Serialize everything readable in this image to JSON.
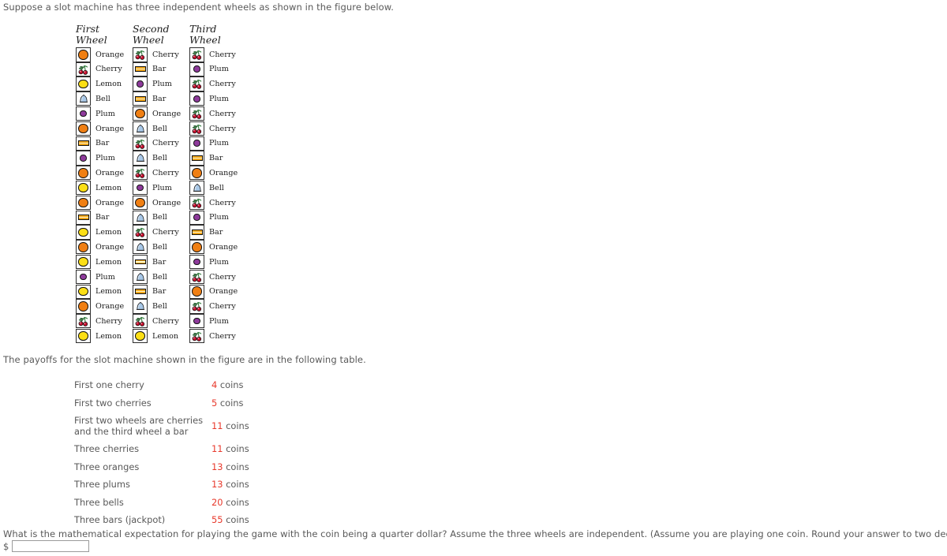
{
  "intro": {
    "text": "Suppose a slot machine has three independent wheels as shown in the figure below."
  },
  "mid": {
    "text": "The payoffs for the slot machine shown in the figure are in the following table."
  },
  "question": {
    "text": "What is the mathematical expectation for playing the game with the coin being a quarter dollar? Assume the three wheels are independent. (Assume you are playing one coin. Round your answer to two decimal places.)",
    "currency_symbol": "$",
    "answer_value": "",
    "answer_placeholder": ""
  },
  "figure": {
    "colors": {
      "orange": "#f07f13",
      "lemon": "#fcdf15",
      "plum": "#8e3a9b",
      "bar": "#f3a81c",
      "bell": "#a8c8e8",
      "cherry_fruit": "#c8102e",
      "cherry_stem": "#2f7a3a",
      "cell_border": "#2d2d2d"
    },
    "wheels": [
      {
        "title": "First\nWheel",
        "symbols": [
          "Orange",
          "Cherry",
          "Lemon",
          "Bell",
          "Plum",
          "Orange",
          "Bar",
          "Plum",
          "Orange",
          "Lemon",
          "Orange",
          "Bar",
          "Lemon",
          "Orange",
          "Lemon",
          "Plum",
          "Lemon",
          "Orange",
          "Cherry",
          "Lemon"
        ]
      },
      {
        "title": "Second\nWheel",
        "symbols": [
          "Cherry",
          "Bar",
          "Plum",
          "Bar",
          "Orange",
          "Bell",
          "Cherry",
          "Bell",
          "Cherry",
          "Plum",
          "Orange",
          "Bell",
          "Cherry",
          "Bell",
          "Bar",
          "Bell",
          "Bar",
          "Bell",
          "Cherry",
          "Lemon"
        ]
      },
      {
        "title": "Third\nWheel",
        "symbols": [
          "Cherry",
          "Plum",
          "Cherry",
          "Plum",
          "Cherry",
          "Cherry",
          "Plum",
          "Bar",
          "Orange",
          "Bell",
          "Cherry",
          "Plum",
          "Bar",
          "Orange",
          "Plum",
          "Cherry",
          "Orange",
          "Cherry",
          "Plum",
          "Cherry"
        ]
      }
    ]
  },
  "payoff_table": {
    "unit": "coins",
    "rows": [
      {
        "description": "First one cherry",
        "amount": "4"
      },
      {
        "description": "First two cherries",
        "amount": "5"
      },
      {
        "description": "First two wheels are cherries\n  and the third wheel a bar",
        "amount": "11"
      },
      {
        "description": "Three cherries",
        "amount": "11"
      },
      {
        "description": "Three oranges",
        "amount": "13"
      },
      {
        "description": "Three plums",
        "amount": "13"
      },
      {
        "description": "Three bells",
        "amount": "20"
      },
      {
        "description": "Three bars (jackpot)",
        "amount": "55"
      }
    ]
  }
}
